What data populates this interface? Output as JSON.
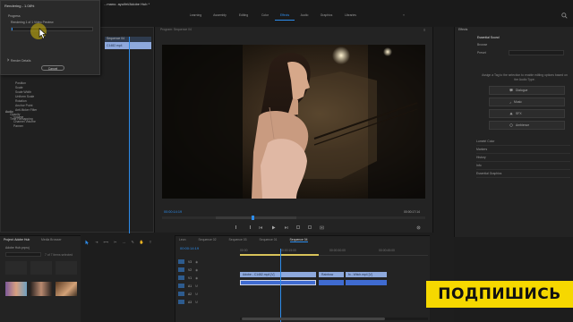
{
  "titlebar": {
    "dialog_title": "Rendering - 1.08%",
    "app_title": "...mano. ayu/fel/Adobe Hub *"
  },
  "workspaces": [
    {
      "label": "Learning",
      "active": false
    },
    {
      "label": "Assembly",
      "active": false
    },
    {
      "label": "Editing",
      "active": false
    },
    {
      "label": "Color",
      "active": false
    },
    {
      "label": "Effects",
      "active": true
    },
    {
      "label": "Audio",
      "active": false
    },
    {
      "label": "Graphics",
      "active": false
    },
    {
      "label": "Libraries",
      "active": false
    }
  ],
  "render_dialog": {
    "progress_label": "Progress",
    "progress_text": "Rendering 1 of 1 Video Preview",
    "progress": 0.0108,
    "details_label": "Render Details",
    "cancel_label": "Cancel"
  },
  "effect_controls": {
    "clip_tab": "Sequence 04",
    "clip_name": "C1482.mp4",
    "rows": [
      "Position",
      "Scale",
      "Scale Width",
      "Uniform Scale",
      "Rotation",
      "Anchor Point",
      "Anti-flicker Filter",
      "Opacity",
      "Time Remapping"
    ],
    "audio_header": "Audio",
    "audio_rows": [
      "Volume",
      "Channel Volume",
      "Panner"
    ]
  },
  "program_monitor": {
    "title": "Program: Sequence 04",
    "timecode_left": "00:00:14:19",
    "timecode_right": "00:00:17:14",
    "zoom": "Fit",
    "quality": "Full"
  },
  "essential_sound": {
    "panel_title": "Effects",
    "tab": "Essential Sound",
    "subtitle": "Browse",
    "preset_label": "Preset",
    "hint": "Assign a Tag to the selection to enable editing options based on the Audio Type.",
    "types": [
      {
        "icon": "dialogue-icon",
        "label": "Dialogue"
      },
      {
        "icon": "music-note-icon",
        "label": "Music"
      },
      {
        "icon": "sfx-icon",
        "label": "SFX"
      },
      {
        "icon": "ambience-icon",
        "label": "Ambience"
      }
    ],
    "sections": [
      "Lumetri Color",
      "Markers",
      "History",
      "Info",
      "Essential Graphics"
    ]
  },
  "project": {
    "tabs": [
      "Project: Adobe Hub",
      "Media Browser"
    ],
    "file_name": "Adobe Hub.prproj",
    "item_count": "7 of 7 items selected"
  },
  "timeline": {
    "tabs": [
      "Leon",
      "Sequence 02",
      "Sequence 03",
      "Sequence 01",
      "Sequence 04"
    ],
    "active_tab": "Sequence 04",
    "timecode": "00:00:14:19",
    "ruler": [
      "00:00",
      "00:00:15:00",
      "00:00:30:00",
      "00:00:45:00"
    ],
    "tracks": [
      "V3",
      "V2",
      "V1",
      "A1",
      "A2",
      "A3"
    ],
    "clips": [
      {
        "label": "Adobe - C1482.mp4 [V]"
      },
      {
        "label": "Rainbow"
      },
      {
        "label": "fx - Witch.mp4 [V]"
      }
    ]
  },
  "overlay": {
    "subscribe_label": "ПОДПИШИСЬ"
  },
  "colors": {
    "accent_blue": "#2d8ceb",
    "subscribe_yellow": "#f6d800",
    "clip_blue": "#8ea9dd",
    "clip_audio": "#3f6bd1"
  }
}
